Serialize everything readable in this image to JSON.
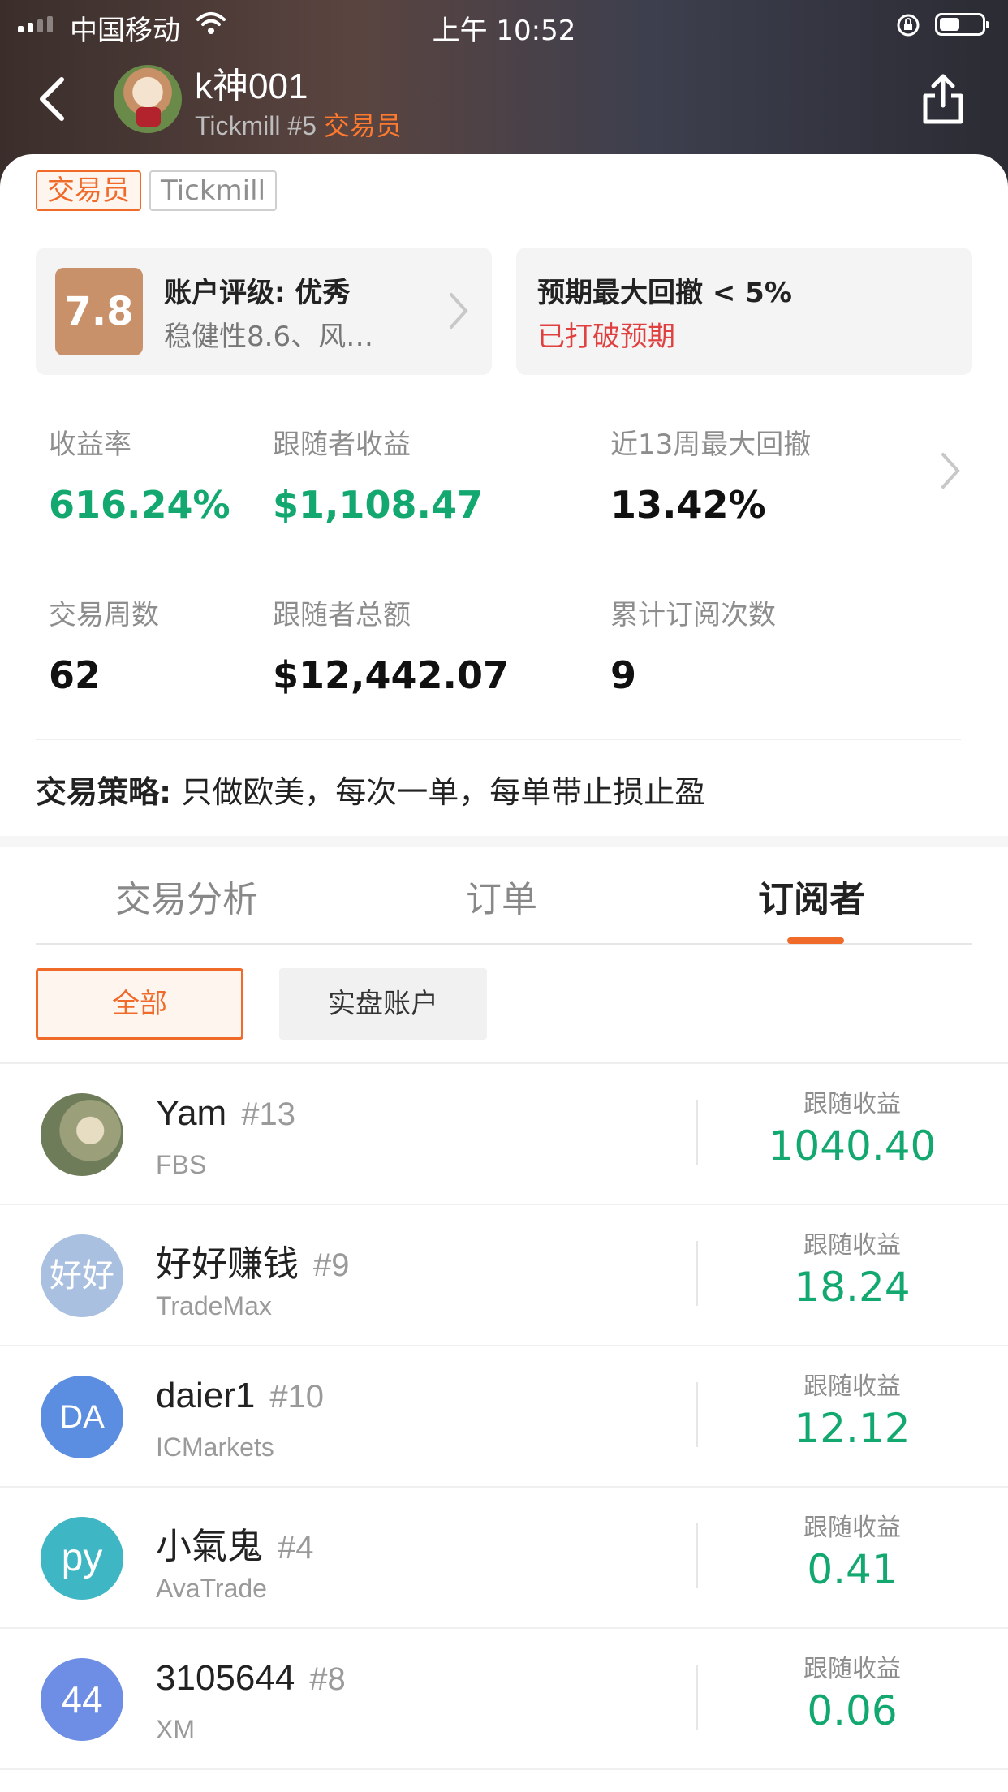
{
  "status_bar": {
    "carrier": "中国移动",
    "time": "上午 10:52"
  },
  "header": {
    "username": "k神001",
    "broker_rank": "Tickmill #5",
    "role": "交易员"
  },
  "tags": [
    "交易员",
    "Tickmill"
  ],
  "rating": {
    "score": "7.8",
    "title": "账户评级: 优秀",
    "detail": "稳健性8.6、风…"
  },
  "drawdown": {
    "title": "预期最大回撤 < 5%",
    "status": "已打破预期"
  },
  "stats": [
    {
      "label": "收益率",
      "value": "616.24%"
    },
    {
      "label": "跟随者收益",
      "value": "$1,108.47"
    },
    {
      "label": "近13周最大回撤",
      "value": "13.42%"
    },
    {
      "label": "交易周数",
      "value": "62"
    },
    {
      "label": "跟随者总额",
      "value": "$12,442.07"
    },
    {
      "label": "累计订阅次数",
      "value": "9"
    }
  ],
  "strategy": {
    "label": "交易策略:",
    "text": "只做欧美，每次一单，每单带止损止盈"
  },
  "tabs": [
    "交易分析",
    "订单",
    "订阅者"
  ],
  "filters": {
    "all": "全部",
    "real": "实盘账户"
  },
  "subscribers": [
    {
      "name": "Yam",
      "rank": "#13",
      "broker": "FBS",
      "avatar_text": "",
      "avatar_color": "#8a9a6a",
      "follow_label": "跟随收益",
      "follow_value": "1040.40"
    },
    {
      "name": "好好赚钱",
      "rank": "#9",
      "broker": "TradeMax",
      "avatar_text": "好好",
      "avatar_color": "#a9c0e0",
      "follow_label": "跟随收益",
      "follow_value": "18.24"
    },
    {
      "name": "daier1",
      "rank": "#10",
      "broker": "ICMarkets",
      "avatar_text": "DA",
      "avatar_color": "#5b8ee0",
      "follow_label": "跟随收益",
      "follow_value": "12.12"
    },
    {
      "name": "小氣鬼",
      "rank": "#4",
      "broker": "AvaTrade",
      "avatar_text": "py",
      "avatar_color": "#3fb6c4",
      "follow_label": "跟随收益",
      "follow_value": "0.41"
    },
    {
      "name": "3105644",
      "rank": "#8",
      "broker": "XM",
      "avatar_text": "44",
      "avatar_color": "#6e8ee6",
      "follow_label": "跟随收益",
      "follow_value": "0.06"
    }
  ],
  "colors": {
    "accent_orange": "#f06a2a",
    "profit_green": "#12a870",
    "warning_red": "#e04040"
  }
}
